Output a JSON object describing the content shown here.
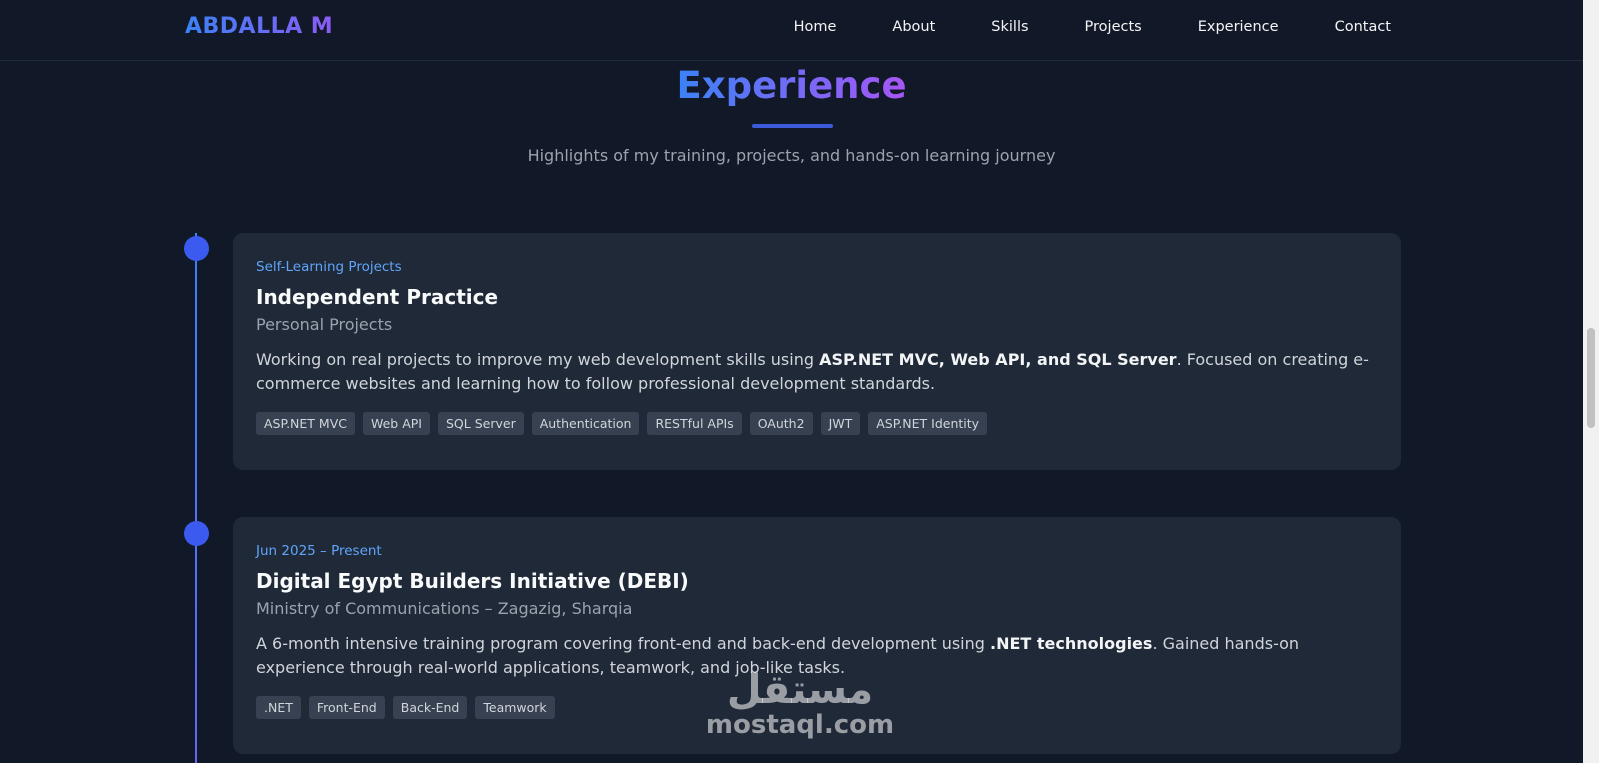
{
  "nav": {
    "logo": "ABDALLA M",
    "links": [
      "Home",
      "About",
      "Skills",
      "Projects",
      "Experience",
      "Contact"
    ]
  },
  "header": {
    "title": "Experience",
    "subtitle": "Highlights of my training, projects, and hands-on learning journey"
  },
  "experiences": [
    {
      "date": "Self-Learning Projects",
      "title": "Independent Practice",
      "org": "Personal Projects",
      "desc_pre": "Working on real projects to improve my web development skills using ",
      "desc_bold": "ASP.NET MVC, Web API, and SQL Server",
      "desc_post": ". Focused on creating e-commerce websites and learning how to follow professional development standards.",
      "tags": [
        "ASP.NET MVC",
        "Web API",
        "SQL Server",
        "Authentication",
        "RESTful APIs",
        "OAuth2",
        "JWT",
        "ASP.NET Identity"
      ]
    },
    {
      "date": "Jun 2025 – Present",
      "title": "Digital Egypt Builders Initiative (DEBI)",
      "org": "Ministry of Communications – Zagazig, Sharqia",
      "desc_pre": "A 6-month intensive training program covering front-end and back-end development using ",
      "desc_bold": ".NET technologies",
      "desc_post": ". Gained hands-on experience through real-world applications, teamwork, and job-like tasks.",
      "tags": [
        ".NET",
        "Front-End",
        "Back-End",
        "Teamwork"
      ]
    }
  ],
  "watermark": {
    "arabic": "مستقل",
    "latin": "mostaql.com"
  },
  "colors": {
    "background": "#111827",
    "card": "#1f2937",
    "accent_blue": "#3b82f6",
    "accent_purple": "#8b5cf6",
    "date_text": "#60a5fa"
  }
}
